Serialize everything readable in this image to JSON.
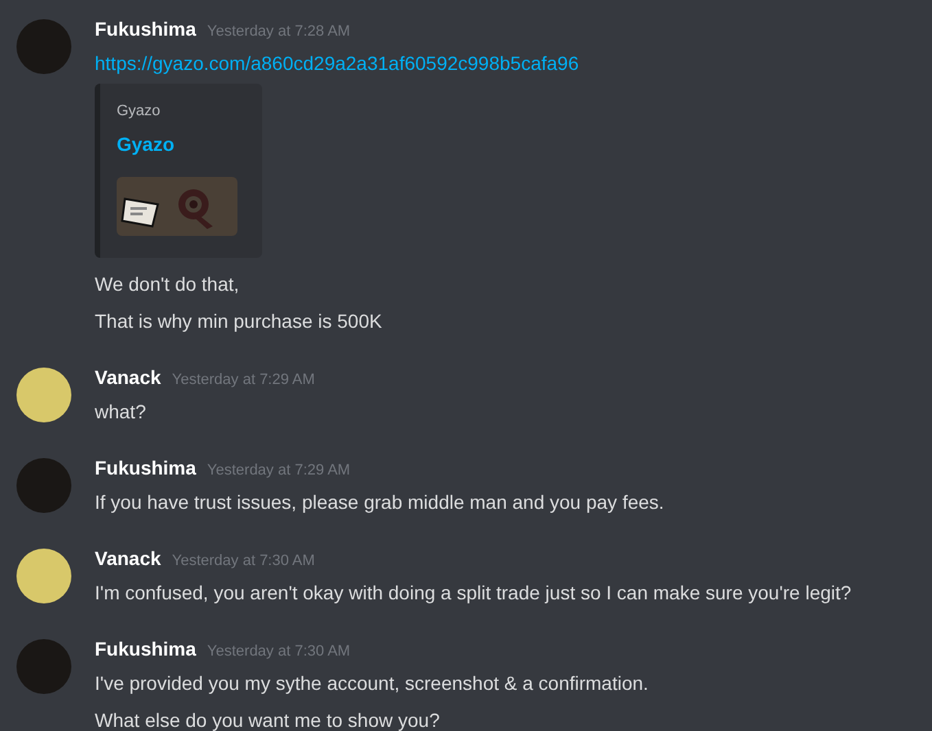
{
  "messages": [
    {
      "author": "Fukushima",
      "timestamp": "Yesterday at 7:28 AM",
      "color": "#1a1715",
      "content": [
        {
          "kind": "link",
          "text": "https://gyazo.com/a860cd29a2a31af60592c998b5cafa96"
        },
        {
          "kind": "embed",
          "provider": "Gyazo",
          "title": "Gyazo"
        },
        {
          "kind": "text",
          "text": "We don't do that,"
        },
        {
          "kind": "text",
          "text": "That is why min purchase is 500K"
        }
      ]
    },
    {
      "author": "Vanack",
      "timestamp": "Yesterday at 7:29 AM",
      "color": "#d8c86a",
      "content": [
        {
          "kind": "text",
          "text": "what?"
        }
      ]
    },
    {
      "author": "Fukushima",
      "timestamp": "Yesterday at 7:29 AM",
      "color": "#1a1715",
      "content": [
        {
          "kind": "text",
          "text": "If you have trust issues, please grab middle man and you pay fees."
        }
      ]
    },
    {
      "author": "Vanack",
      "timestamp": "Yesterday at 7:30 AM",
      "color": "#d8c86a",
      "content": [
        {
          "kind": "text",
          "text": "I'm confused, you aren't okay with doing a split trade just so I can make sure you're legit?"
        }
      ]
    },
    {
      "author": "Fukushima",
      "timestamp": "Yesterday at 7:30 AM",
      "color": "#1a1715",
      "content": [
        {
          "kind": "text",
          "text": "I've provided you my sythe account, screenshot & a confirmation."
        },
        {
          "kind": "text",
          "text": "What else do you want me to show you?"
        }
      ]
    }
  ]
}
